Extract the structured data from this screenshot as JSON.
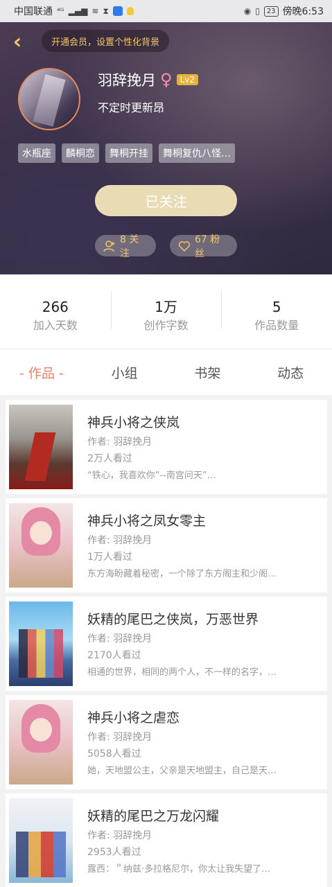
{
  "status_bar": {
    "carrier": "中国联通",
    "network": "⁴ᴳ",
    "battery": "23",
    "time": "傍晚6:53"
  },
  "header": {
    "member_banner": "开通会员，设置个性化背景",
    "username": "羽辞挽月",
    "gender_icon": "♀",
    "level": "Lv2",
    "signature": "不定时更新昂",
    "tags": [
      "水瓶座",
      "麟桐恋",
      "舞桐开挂",
      "舞桐复仇八怪…"
    ],
    "follow_button": "已关注",
    "following_label": "8 关注",
    "fans_label": "67 粉丝"
  },
  "stats": [
    {
      "value": "266",
      "label": "加入天数"
    },
    {
      "value": "1万",
      "label": "创作字数"
    },
    {
      "value": "5",
      "label": "作品数量"
    }
  ],
  "tabs": [
    "作品",
    "小组",
    "书架",
    "动态"
  ],
  "works": [
    {
      "title": "神兵小将之侠岚",
      "author": "作者: 羽辞挽月",
      "views": "2万人看过",
      "desc": "“铁心，我喜欢你”--南宫问天”…",
      "cover": "war"
    },
    {
      "title": "神兵小将之凤女零主",
      "author": "作者: 羽辞挽月",
      "views": "1万人看过",
      "desc": "东方海盼藏着秘密，一个除了东方阁主和少阁…",
      "cover": "girl"
    },
    {
      "title": "妖精的尾巴之侠岚，万恶世界",
      "author": "作者: 羽辞挽月",
      "views": "2170人看过",
      "desc": "相通的世界，相同的两个人，不一样的名字，…",
      "cover": "group"
    },
    {
      "title": "神兵小将之虐恋",
      "author": "作者: 羽辞挽月",
      "views": "5058人看过",
      "desc": "她，天地盟公主，父亲是天地盟主，自己是天…",
      "cover": "girl"
    },
    {
      "title": "妖精的尾巴之万龙闪耀",
      "author": "作者: 羽辞挽月",
      "views": "2953人看过",
      "desc": "露西：＂纳兹·多拉格尼尔，你太让我失望了…",
      "cover": "group2"
    }
  ],
  "colors": {
    "accent": "#e8826a",
    "gold": "#f3c66a",
    "follow_bg": "#e9dcb4"
  }
}
